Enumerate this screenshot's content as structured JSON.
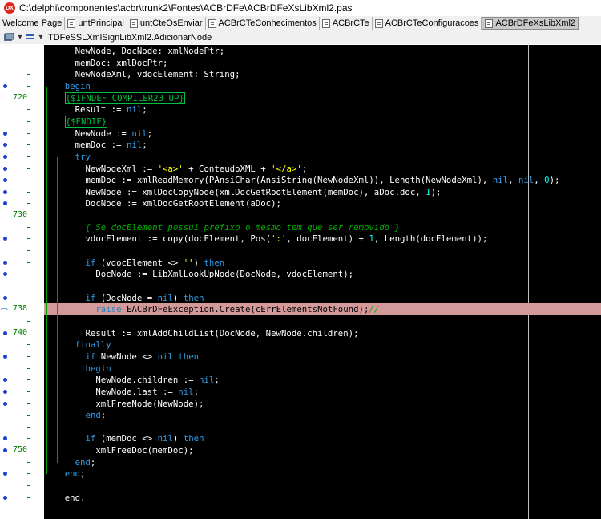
{
  "window": {
    "app_icon": "DX",
    "title": "C:\\delphi\\componentes\\acbr\\trunk2\\Fontes\\ACBrDFe\\ACBrDFeXsLibXml2.pas"
  },
  "tabs": [
    {
      "label": "Welcome Page",
      "icon": "",
      "active": false
    },
    {
      "label": "untPrincipal",
      "icon": "file-icon",
      "active": false
    },
    {
      "label": "untCteOsEnviar",
      "icon": "file-icon",
      "active": false
    },
    {
      "label": "ACBrCTeConhecimentos",
      "icon": "file-icon",
      "active": false
    },
    {
      "label": "ACBrCTe",
      "icon": "file-icon",
      "active": false
    },
    {
      "label": "ACBrCTeConfiguracoes",
      "icon": "file-icon",
      "active": false
    },
    {
      "label": "ACBrDFeXsLibXml2",
      "icon": "file-icon",
      "active": true
    }
  ],
  "navbar": {
    "method_path": "TDFeSSLXmlSignLibXml2.AdicionarNode"
  },
  "colors": {
    "editor_bg": "#000000",
    "keyword": "#2f9ce8",
    "number": "#00ffff",
    "string": "#ffff00",
    "comment": "#00b000",
    "directive": "#00c040",
    "exec_line_bg": "#d49a9a",
    "breakpoint_dot": "#1f3fd9"
  },
  "gutter": [
    {
      "label": "",
      "dot": false,
      "arrow": false
    },
    {
      "label": "",
      "dot": false,
      "arrow": false
    },
    {
      "label": "",
      "dot": false,
      "arrow": false
    },
    {
      "label": "",
      "dot": true,
      "arrow": false
    },
    {
      "label": "720",
      "dot": false,
      "arrow": false
    },
    {
      "label": "",
      "dot": false,
      "arrow": false
    },
    {
      "label": "",
      "dot": false,
      "arrow": false
    },
    {
      "label": "",
      "dot": true,
      "arrow": false
    },
    {
      "label": "",
      "dot": true,
      "arrow": false
    },
    {
      "label": "",
      "dot": true,
      "arrow": false
    },
    {
      "label": "",
      "dot": true,
      "arrow": false
    },
    {
      "label": "",
      "dot": true,
      "arrow": false
    },
    {
      "label": "",
      "dot": true,
      "arrow": false
    },
    {
      "label": "",
      "dot": true,
      "arrow": false
    },
    {
      "label": "730",
      "dot": false,
      "arrow": false
    },
    {
      "label": "",
      "dot": false,
      "arrow": false
    },
    {
      "label": "",
      "dot": true,
      "arrow": false
    },
    {
      "label": "",
      "dot": false,
      "arrow": false
    },
    {
      "label": "",
      "dot": true,
      "arrow": false
    },
    {
      "label": "",
      "dot": true,
      "arrow": false
    },
    {
      "label": "",
      "dot": false,
      "arrow": false
    },
    {
      "label": "",
      "dot": true,
      "arrow": false
    },
    {
      "label": "738",
      "dot": false,
      "arrow": true
    },
    {
      "label": "",
      "dot": false,
      "arrow": false
    },
    {
      "label": "740",
      "dot": true,
      "arrow": false
    },
    {
      "label": "",
      "dot": false,
      "arrow": false
    },
    {
      "label": "",
      "dot": true,
      "arrow": false
    },
    {
      "label": "",
      "dot": false,
      "arrow": false
    },
    {
      "label": "",
      "dot": true,
      "arrow": false
    },
    {
      "label": "",
      "dot": true,
      "arrow": false
    },
    {
      "label": "",
      "dot": true,
      "arrow": false
    },
    {
      "label": "",
      "dot": false,
      "arrow": false
    },
    {
      "label": "",
      "dot": false,
      "arrow": false
    },
    {
      "label": "",
      "dot": true,
      "arrow": false
    },
    {
      "label": "750",
      "dot": true,
      "arrow": false
    },
    {
      "label": "",
      "dot": false,
      "arrow": false
    },
    {
      "label": "",
      "dot": true,
      "arrow": false
    },
    {
      "label": "",
      "dot": false,
      "arrow": false
    },
    {
      "label": "",
      "dot": true,
      "arrow": false
    }
  ],
  "code_lines": [
    [
      {
        "t": "      NewNode, DocNode: xmlNodePtr;",
        "c": ""
      }
    ],
    [
      {
        "t": "      memDoc: xmlDocPtr;",
        "c": ""
      }
    ],
    [
      {
        "t": "      NewNodeXml, vdocElement: String;",
        "c": ""
      }
    ],
    [
      {
        "t": "    ",
        "c": ""
      },
      {
        "t": "begin",
        "c": "k"
      }
    ],
    [
      {
        "t": "    ",
        "c": ""
      },
      {
        "t": "{$IFNDEF COMPILER23_UP}",
        "c": "d box"
      }
    ],
    [
      {
        "t": "      Result := ",
        "c": ""
      },
      {
        "t": "nil",
        "c": "k"
      },
      {
        "t": ";",
        "c": ""
      }
    ],
    [
      {
        "t": "    ",
        "c": ""
      },
      {
        "t": "{$ENDIF}",
        "c": "d box"
      }
    ],
    [
      {
        "t": "      NewNode := ",
        "c": ""
      },
      {
        "t": "nil",
        "c": "k"
      },
      {
        "t": ";",
        "c": ""
      }
    ],
    [
      {
        "t": "      memDoc := ",
        "c": ""
      },
      {
        "t": "nil",
        "c": "k"
      },
      {
        "t": ";",
        "c": ""
      }
    ],
    [
      {
        "t": "      ",
        "c": ""
      },
      {
        "t": "try",
        "c": "k"
      }
    ],
    [
      {
        "t": "        NewNodeXml := ",
        "c": ""
      },
      {
        "t": "'<a>'",
        "c": "s"
      },
      {
        "t": " + ConteudoXML + ",
        "c": ""
      },
      {
        "t": "'</a>'",
        "c": "s"
      },
      {
        "t": ";",
        "c": ""
      }
    ],
    [
      {
        "t": "        memDoc := xmlReadMemory(PAnsiChar(AnsiString(NewNodeXml)), Length(NewNodeXml), ",
        "c": ""
      },
      {
        "t": "nil",
        "c": "k"
      },
      {
        "t": ", ",
        "c": ""
      },
      {
        "t": "nil",
        "c": "k"
      },
      {
        "t": ", ",
        "c": ""
      },
      {
        "t": "0",
        "c": "n"
      },
      {
        "t": ");",
        "c": ""
      }
    ],
    [
      {
        "t": "        NewNode := xmlDocCopyNode(xmlDocGetRootElement(memDoc), aDoc.doc, ",
        "c": ""
      },
      {
        "t": "1",
        "c": "n"
      },
      {
        "t": ");",
        "c": ""
      }
    ],
    [
      {
        "t": "        DocNode := xmlDocGetRootElement(aDoc);",
        "c": ""
      }
    ],
    [
      {
        "t": "",
        "c": ""
      }
    ],
    [
      {
        "t": "        ",
        "c": ""
      },
      {
        "t": "{ Se docElement possui prefixo o mesmo tem que ser removido }",
        "c": "c"
      }
    ],
    [
      {
        "t": "        vdocElement := copy(docElement, Pos(",
        "c": ""
      },
      {
        "t": "':'",
        "c": "s"
      },
      {
        "t": ", docElement) + ",
        "c": ""
      },
      {
        "t": "1",
        "c": "n"
      },
      {
        "t": ", Length(docElement));",
        "c": ""
      }
    ],
    [
      {
        "t": "",
        "c": ""
      }
    ],
    [
      {
        "t": "        ",
        "c": ""
      },
      {
        "t": "if",
        "c": "k"
      },
      {
        "t": " (vdocElement <> ",
        "c": ""
      },
      {
        "t": "''",
        "c": "s"
      },
      {
        "t": ") ",
        "c": ""
      },
      {
        "t": "then",
        "c": "k"
      }
    ],
    [
      {
        "t": "          DocNode := LibXmlLookUpNode(DocNode, vdocElement);",
        "c": ""
      }
    ],
    [
      {
        "t": "",
        "c": ""
      }
    ],
    [
      {
        "t": "        ",
        "c": ""
      },
      {
        "t": "if",
        "c": "k"
      },
      {
        "t": " (DocNode = ",
        "c": ""
      },
      {
        "t": "nil",
        "c": "k"
      },
      {
        "t": ") ",
        "c": ""
      },
      {
        "t": "then",
        "c": "k"
      }
    ],
    [
      {
        "t": "          ",
        "c": "t"
      },
      {
        "t": "raise",
        "c": "k"
      },
      {
        "t": " EACBrDFeException.Create(cErrElementsNotFound);",
        "c": "t"
      },
      {
        "t": "//",
        "c": "c"
      }
    ],
    [
      {
        "t": "",
        "c": ""
      }
    ],
    [
      {
        "t": "        Result := xmlAddChildList(DocNode, NewNode.children);",
        "c": ""
      }
    ],
    [
      {
        "t": "      ",
        "c": ""
      },
      {
        "t": "finally",
        "c": "k"
      }
    ],
    [
      {
        "t": "        ",
        "c": ""
      },
      {
        "t": "if",
        "c": "k"
      },
      {
        "t": " NewNode <> ",
        "c": ""
      },
      {
        "t": "nil",
        "c": "k"
      },
      {
        "t": " ",
        "c": ""
      },
      {
        "t": "then",
        "c": "k"
      }
    ],
    [
      {
        "t": "        ",
        "c": ""
      },
      {
        "t": "begin",
        "c": "k"
      }
    ],
    [
      {
        "t": "          NewNode.children := ",
        "c": ""
      },
      {
        "t": "nil",
        "c": "k"
      },
      {
        "t": ";",
        "c": ""
      }
    ],
    [
      {
        "t": "          NewNode.last := ",
        "c": ""
      },
      {
        "t": "nil",
        "c": "k"
      },
      {
        "t": ";",
        "c": ""
      }
    ],
    [
      {
        "t": "          xmlFreeNode(NewNode);",
        "c": ""
      }
    ],
    [
      {
        "t": "        ",
        "c": ""
      },
      {
        "t": "end",
        "c": "k"
      },
      {
        "t": ";",
        "c": ""
      }
    ],
    [
      {
        "t": "",
        "c": ""
      }
    ],
    [
      {
        "t": "        ",
        "c": ""
      },
      {
        "t": "if",
        "c": "k"
      },
      {
        "t": " (memDoc <> ",
        "c": ""
      },
      {
        "t": "nil",
        "c": "k"
      },
      {
        "t": ") ",
        "c": ""
      },
      {
        "t": "then",
        "c": "k"
      }
    ],
    [
      {
        "t": "          xmlFreeDoc(memDoc);",
        "c": ""
      }
    ],
    [
      {
        "t": "      ",
        "c": ""
      },
      {
        "t": "end",
        "c": "k"
      },
      {
        "t": ";",
        "c": ""
      }
    ],
    [
      {
        "t": "    ",
        "c": ""
      },
      {
        "t": "end",
        "c": "k"
      },
      {
        "t": ";",
        "c": ""
      }
    ],
    [
      {
        "t": "",
        "c": ""
      }
    ],
    [
      {
        "t": "    end.",
        "c": ""
      }
    ]
  ]
}
